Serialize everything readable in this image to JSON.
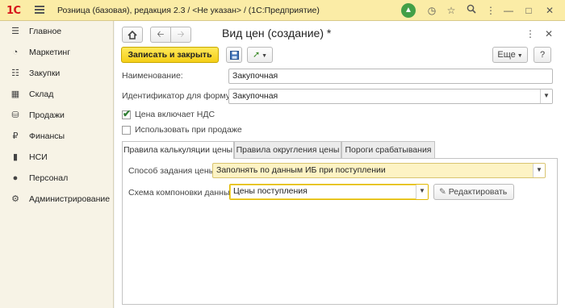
{
  "app": {
    "logo": "1С",
    "title": "Розница (базовая), редакция 2.3 / <Не указан> / (1С:Предприятие)"
  },
  "sidebar": {
    "items": [
      {
        "label": "Главное",
        "icon": "menu-lines-icon"
      },
      {
        "label": "Маркетинг",
        "icon": "pie-chart-icon"
      },
      {
        "label": "Закупки",
        "icon": "cart-list-icon"
      },
      {
        "label": "Склад",
        "icon": "warehouse-grid-icon"
      },
      {
        "label": "Продажи",
        "icon": "basket-icon"
      },
      {
        "label": "Финансы",
        "icon": "ruble-coin-icon"
      },
      {
        "label": "НСИ",
        "icon": "reference-book-icon"
      },
      {
        "label": "Персонал",
        "icon": "person-icon"
      },
      {
        "label": "Администрирование",
        "icon": "gear-icon"
      }
    ]
  },
  "form": {
    "title": "Вид цен (создание) *",
    "save_close_label": "Записать и закрыть",
    "more_label": "Еще",
    "help_label": "?",
    "name_label": "Наименование:",
    "name_value": "Закупочная",
    "formula_id_label": "Идентификатор для формул:",
    "formula_id_value": "Закупочная",
    "price_includes_vat_label": "Цена включает НДС",
    "price_includes_vat_checked": true,
    "use_in_sales_label": "Использовать при продаже",
    "use_in_sales_checked": false,
    "tabs": [
      {
        "label": "Правила калькуляции цены",
        "active": true
      },
      {
        "label": "Правила округления цены",
        "active": false
      },
      {
        "label": "Пороги срабатывания",
        "active": false
      }
    ],
    "price_method_label": "Способ задания цены:",
    "price_method_value": "Заполнять по данным ИБ при поступлении",
    "layout_scheme_label": "Схема компоновки данных:",
    "layout_scheme_value": "Цены поступления",
    "edit_label": "Редактировать"
  },
  "colors": {
    "titlebar_bg": "#fbeca6",
    "primary_button": "#f5cf18",
    "notification_green": "#43a047",
    "logo_red": "#d6141c"
  }
}
